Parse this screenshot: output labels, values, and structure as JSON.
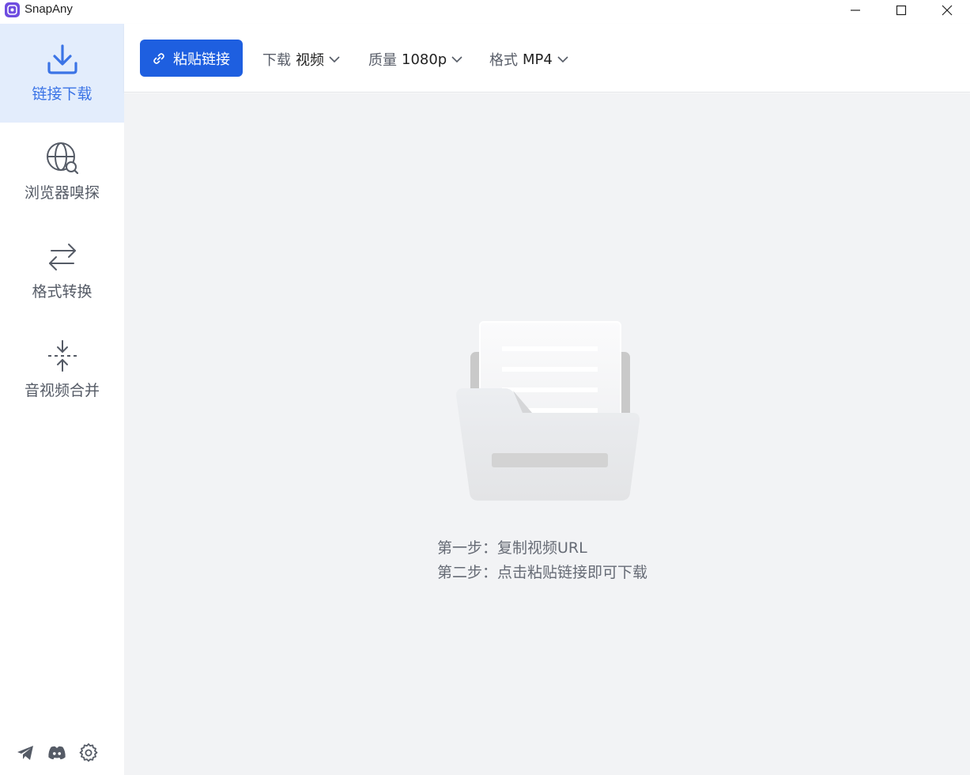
{
  "window": {
    "title": "SnapAny",
    "controls": [
      "minimize",
      "maximize",
      "close"
    ]
  },
  "sidebar": {
    "items": [
      {
        "label": "链接下载",
        "icon": "download-icon",
        "active": true
      },
      {
        "label": "浏览器嗅探",
        "icon": "globe-search-icon",
        "active": false
      },
      {
        "label": "格式转换",
        "icon": "convert-arrows-icon",
        "active": false
      },
      {
        "label": "音视频合并",
        "icon": "merge-icon",
        "active": false
      }
    ],
    "bottom_icons": [
      "telegram-icon",
      "discord-icon",
      "settings-gear-icon"
    ]
  },
  "toolbar": {
    "paste_label": "粘贴链接",
    "download": {
      "key": "下载",
      "value": "视频"
    },
    "quality": {
      "key": "质量",
      "value": "1080p"
    },
    "format": {
      "key": "格式",
      "value": "MP4"
    }
  },
  "empty_state": {
    "step1": "第一步：复制视频URL",
    "step2": "第二步：点击粘贴链接即可下载"
  },
  "colors": {
    "accent": "#1e5fe0",
    "active_nav_bg": "#e3edfc",
    "active_nav_text": "#3b74e6",
    "content_bg": "#f2f3f5"
  }
}
